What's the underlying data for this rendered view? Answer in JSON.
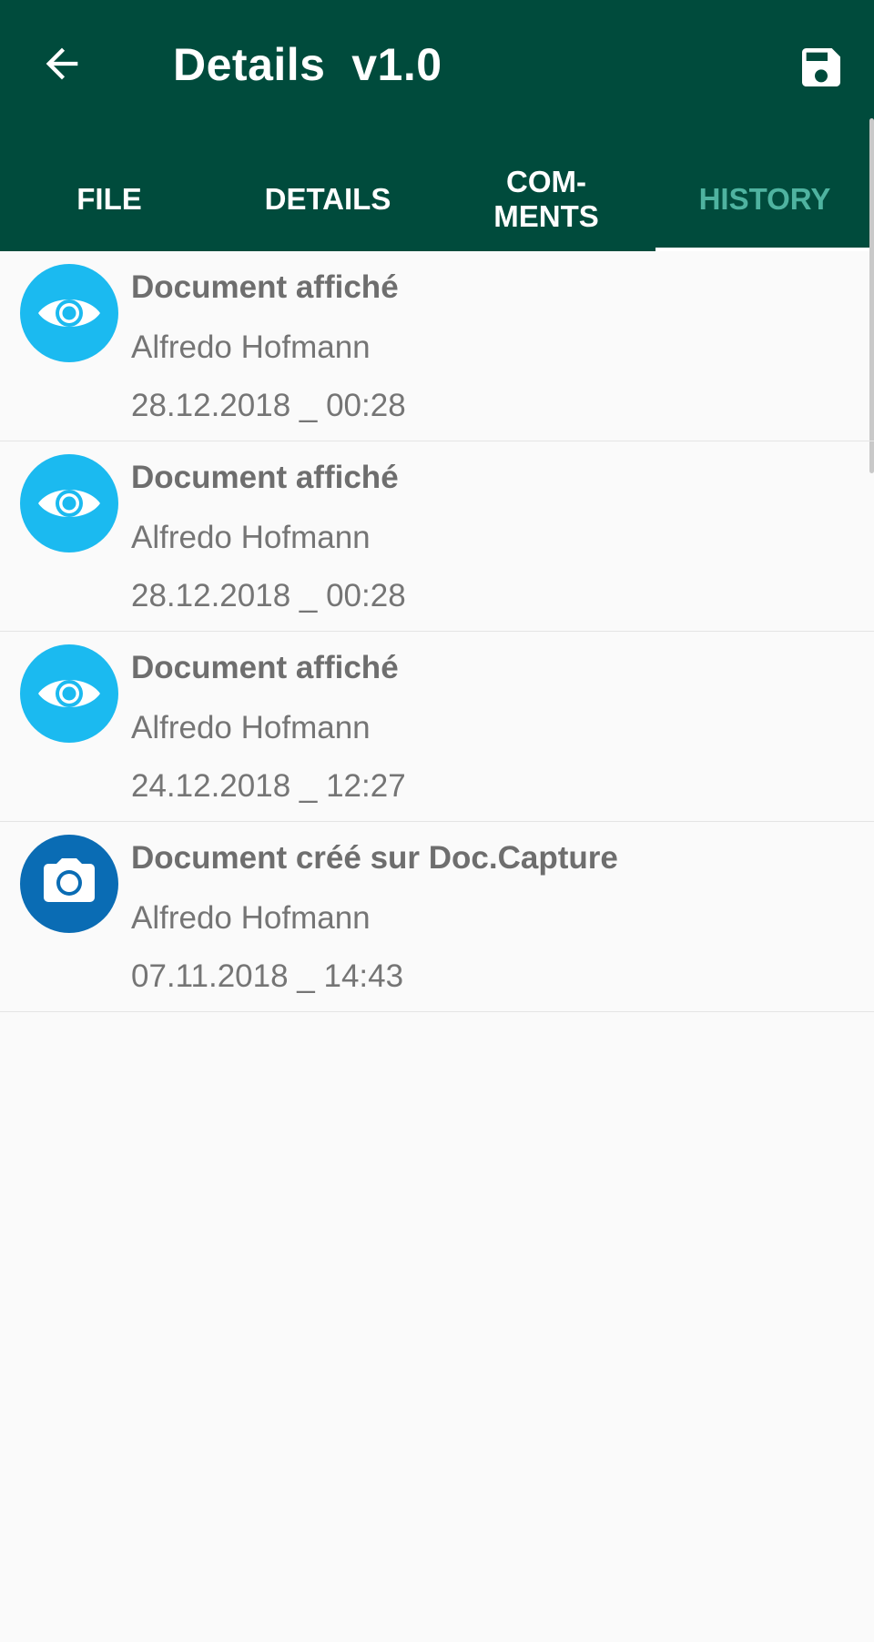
{
  "header": {
    "title": "Details  v1.0",
    "back_icon": "arrow-back-icon",
    "save_icon": "floppy-disk-icon",
    "background_color": "#004b3c"
  },
  "tabs": [
    {
      "label": "FILE",
      "active": false
    },
    {
      "label": "DETAILS",
      "active": false
    },
    {
      "label": "COM-\nMENTS",
      "active": false
    },
    {
      "label": "HISTORY",
      "active": true
    }
  ],
  "colors": {
    "active_tab": "#4fb3a0",
    "view_icon_bg": "#1bbaf0",
    "capture_icon_bg": "#0a6cb4"
  },
  "history": [
    {
      "icon": "eye-icon",
      "action": "Document affiché",
      "user": "Alfredo Hofmann",
      "datetime": "28.12.2018 _ 00:28"
    },
    {
      "icon": "eye-icon",
      "action": "Document affiché",
      "user": "Alfredo Hofmann",
      "datetime": "28.12.2018 _ 00:28"
    },
    {
      "icon": "eye-icon",
      "action": "Document affiché",
      "user": "Alfredo Hofmann",
      "datetime": "24.12.2018 _ 12:27"
    },
    {
      "icon": "camera-icon",
      "action": "Document créé sur Doc.Capture",
      "user": "Alfredo Hofmann",
      "datetime": "07.11.2018 _ 14:43"
    }
  ]
}
